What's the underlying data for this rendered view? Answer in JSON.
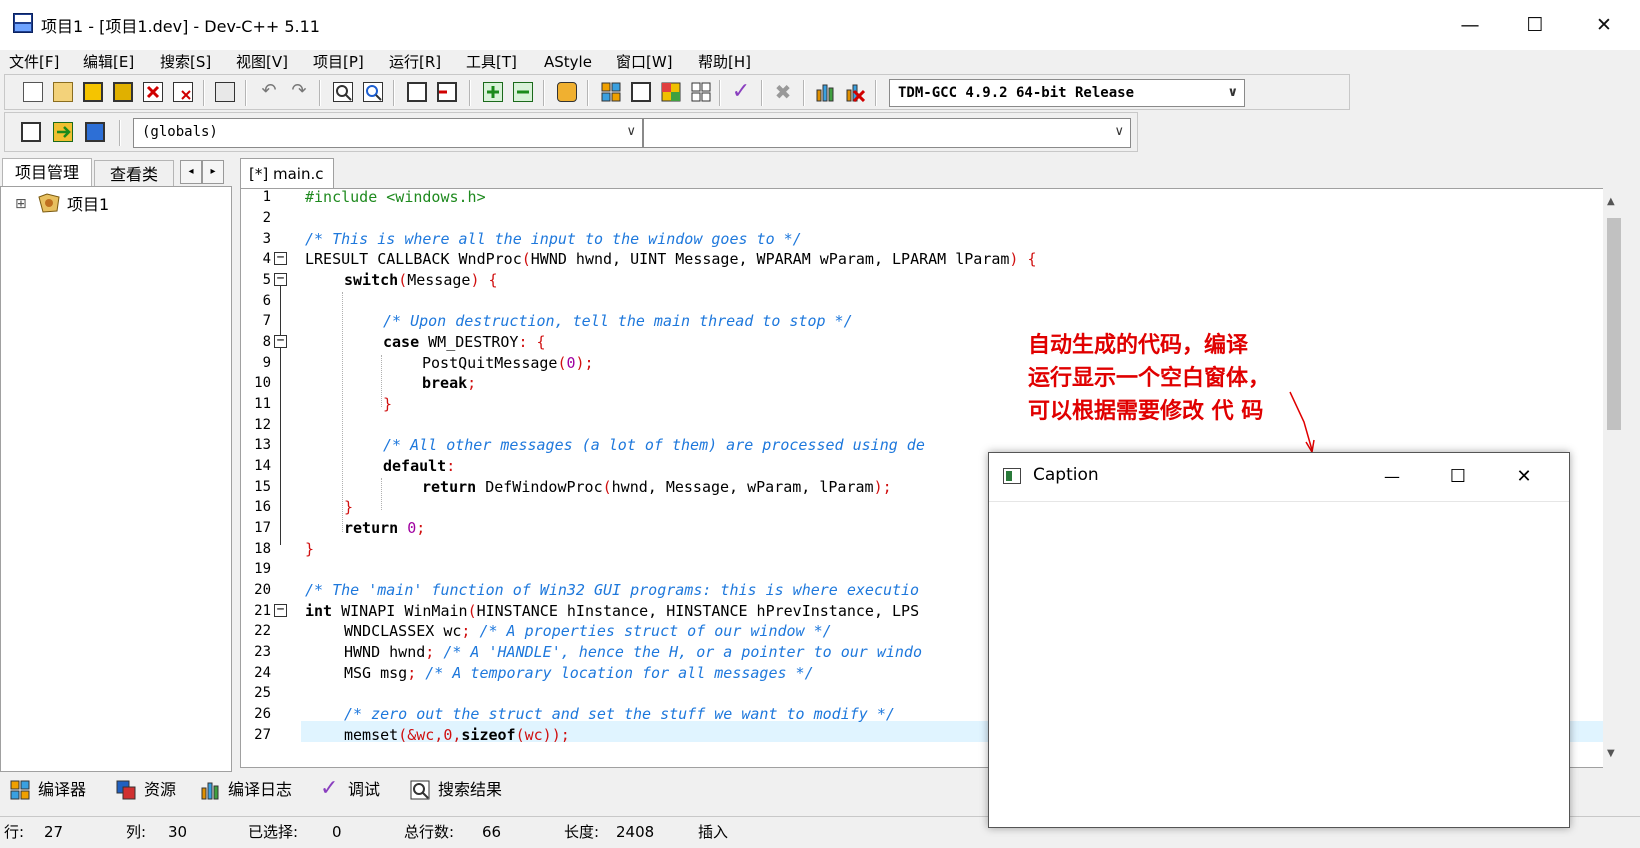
{
  "window": {
    "title": "项目1 - [项目1.dev] - Dev-C++ 5.11",
    "app_icon": "dev-cpp-icon",
    "minimize": "—",
    "maximize": "☐",
    "close": "✕"
  },
  "menu": [
    "文件[F]",
    "编辑[E]",
    "搜索[S]",
    "视图[V]",
    "项目[P]",
    "运行[R]",
    "工具[T]",
    "AStyle",
    "窗口[W]",
    "帮助[H]"
  ],
  "toolbar": {
    "compiler_select": "TDM-GCC 4.9.2 64-bit Release",
    "scope_select": "(globals)",
    "function_select": ""
  },
  "left_panel": {
    "tabs": [
      "项目管理",
      "查看类"
    ],
    "tree_root": "项目1",
    "expand_glyph": "⊞"
  },
  "editor": {
    "tab_label": "[*] main.c",
    "lines": [
      {
        "n": "1"
      },
      {
        "n": "2"
      },
      {
        "n": "3"
      },
      {
        "n": "4"
      },
      {
        "n": "5"
      },
      {
        "n": "6"
      },
      {
        "n": "7"
      },
      {
        "n": "8"
      },
      {
        "n": "9"
      },
      {
        "n": "10"
      },
      {
        "n": "11"
      },
      {
        "n": "12"
      },
      {
        "n": "13"
      },
      {
        "n": "14"
      },
      {
        "n": "15"
      },
      {
        "n": "16"
      },
      {
        "n": "17"
      },
      {
        "n": "18"
      },
      {
        "n": "19"
      },
      {
        "n": "20"
      },
      {
        "n": "21"
      },
      {
        "n": "22"
      },
      {
        "n": "23"
      },
      {
        "n": "24"
      },
      {
        "n": "25"
      },
      {
        "n": "26"
      },
      {
        "n": "27"
      }
    ],
    "code": {
      "l1": "#include <windows.h>",
      "l3": "/* This is where all the input to the window goes to */",
      "l4a": "LRESULT CALLBACK WndProc",
      "l4b": "(",
      "l4c": "HWND hwnd, UINT Message, WPARAM wParam, LPARAM lParam",
      "l4d": ") {",
      "l5a": "switch",
      "l5b": "(",
      "l5c": "Message",
      "l5d": ") {",
      "l7": "/* Upon destruction, tell the main thread to stop */",
      "l8a": "case",
      "l8b": " WM_DESTROY",
      "l8c": ": {",
      "l9a": "PostQuitMessage",
      "l9b": "(",
      "l9c": "0",
      "l9d": ");",
      "l10a": "break",
      "l10b": ";",
      "l11": "}",
      "l13": "/* All other messages (a lot of them) are processed using de",
      "l14a": "default",
      "l14b": ":",
      "l15a": "return",
      "l15b": " DefWindowProc",
      "l15c": "(",
      "l15d": "hwnd, Message, wParam, lParam",
      "l15e": ");",
      "l16": "}",
      "l17a": "return",
      "l17b": " 0",
      "l17c": ";",
      "l18": "}",
      "l20": "/* The 'main' function of Win32 GUI programs: this is where executio",
      "l21a": "int",
      "l21b": " WINAPI WinMain",
      "l21c": "(",
      "l21d": "HINSTANCE hInstance, HINSTANCE hPrevInstance, LPS",
      "l22a": "WNDCLASSEX wc",
      "l22b": ";",
      "l22c": " /* A properties struct of our window */",
      "l23a": "HWND hwnd",
      "l23b": ";",
      "l23c": " /* A 'HANDLE', hence the H, or a pointer to our windo",
      "l24a": "MSG msg",
      "l24b": ";",
      "l24c": " /* A temporary location for all messages */",
      "l26": "/* zero out the struct and set the stuff we want to modify */",
      "l27a": "memset",
      "l27b": "(&wc,0,",
      "l27c": "sizeof",
      "l27d": "(wc));"
    }
  },
  "bottom_tabs": [
    "编译器",
    "资源",
    "编译日志",
    "调试",
    "搜索结果"
  ],
  "status": {
    "row_label": "行:",
    "row": "27",
    "col_label": "列:",
    "col": "30",
    "sel_label": "已选择:",
    "sel": "0",
    "total_label": "总行数:",
    "total": "66",
    "len_label": "长度:",
    "len": "2408",
    "mode": "插入"
  },
  "annotation": {
    "line1": "自动生成的代码，编译",
    "line2": "运行显示一个空白窗体，",
    "line3": "可以根据需要修改 代  码"
  },
  "child_window": {
    "title": "Caption",
    "minimize": "—",
    "maximize": "☐",
    "close": "✕"
  },
  "colors": {
    "keyword": "#000000",
    "comment": "#1e78dc",
    "preprocessor": "#1f8a1f",
    "number": "#a000a0",
    "symbol": "#d01010",
    "annotation": "#e00000",
    "current_line": "#e0f4ff"
  }
}
